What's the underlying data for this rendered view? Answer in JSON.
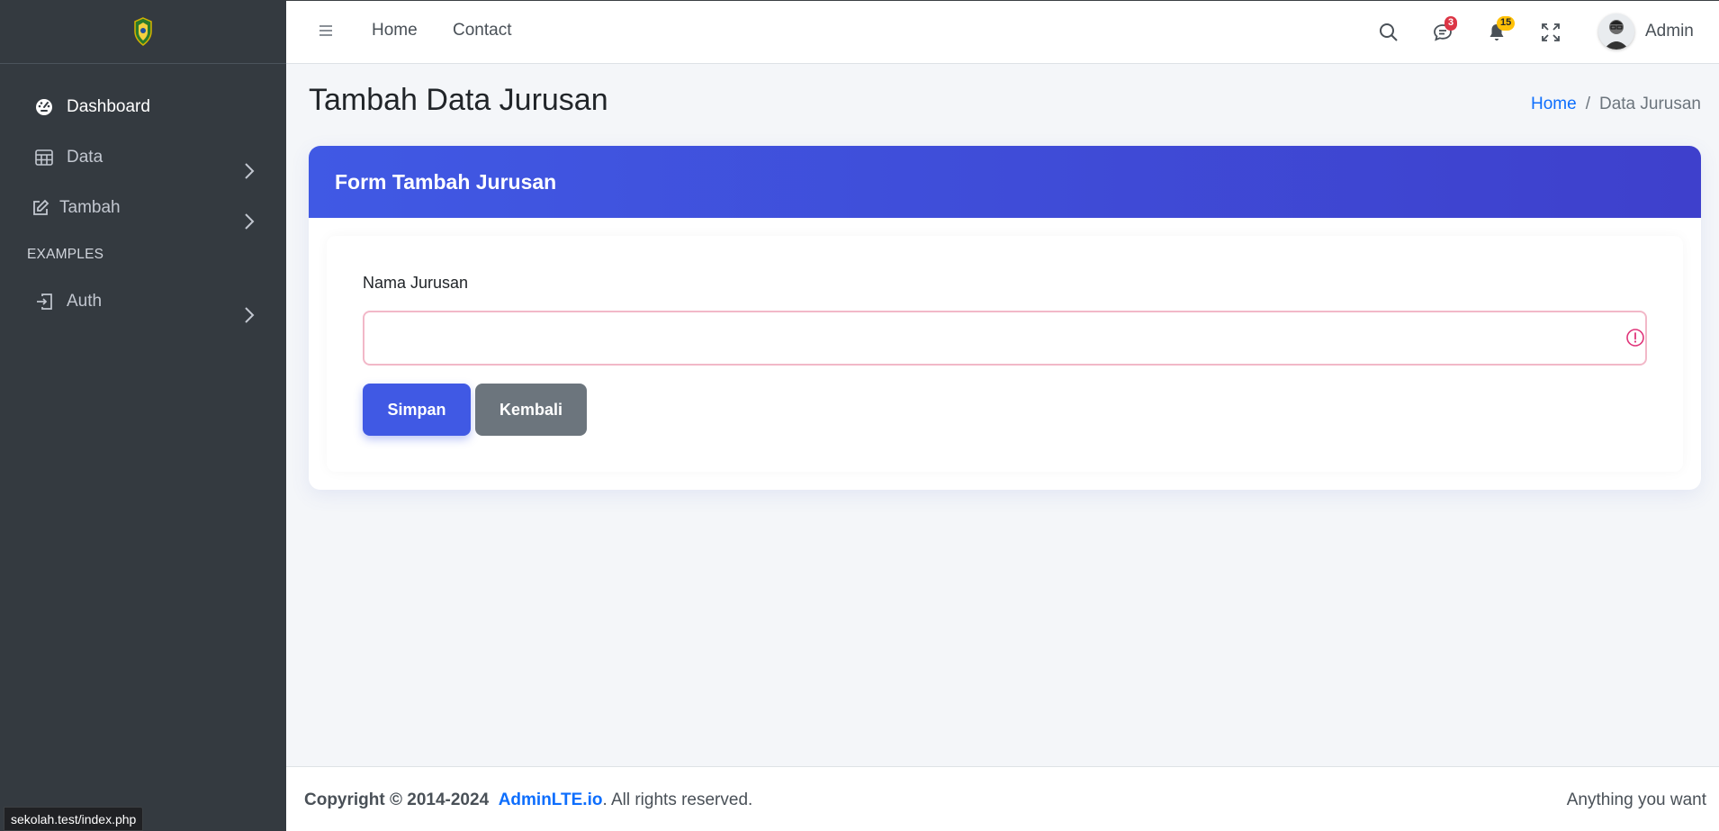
{
  "sidebar": {
    "items": [
      {
        "label": "Dashboard",
        "icon": "speedometer-icon"
      },
      {
        "label": "Data",
        "icon": "table-icon"
      },
      {
        "label": "Tambah",
        "icon": "pencil-square-icon"
      },
      {
        "label": "Auth",
        "icon": "box-arrow-in-right-icon"
      }
    ],
    "header": "EXAMPLES"
  },
  "topbar": {
    "links": [
      "Home",
      "Contact"
    ],
    "messages_count": "3",
    "notifications_count": "15",
    "user_name": "Admin"
  },
  "page": {
    "title": "Tambah Data Jurusan",
    "breadcrumb": {
      "home": "Home",
      "separator": "/",
      "current": "Data Jurusan"
    }
  },
  "form": {
    "card_title": "Form Tambah Jurusan",
    "field_label": "Nama Jurusan",
    "field_value": "",
    "submit_label": "Simpan",
    "back_label": "Kembali"
  },
  "footer": {
    "copyright": "Copyright © 2014-2024",
    "brand": "AdminLTE.io",
    "rights": ". All rights reserved.",
    "right_text": "Anything you want"
  },
  "status_url": "sekolah.test/index.php",
  "colors": {
    "sidebar_bg": "#343a40",
    "accent": "#4059e4",
    "link": "#0d6efd",
    "invalid_border": "#f2b8c8",
    "badge_danger": "#dc3545",
    "badge_warning": "#ffc107"
  }
}
